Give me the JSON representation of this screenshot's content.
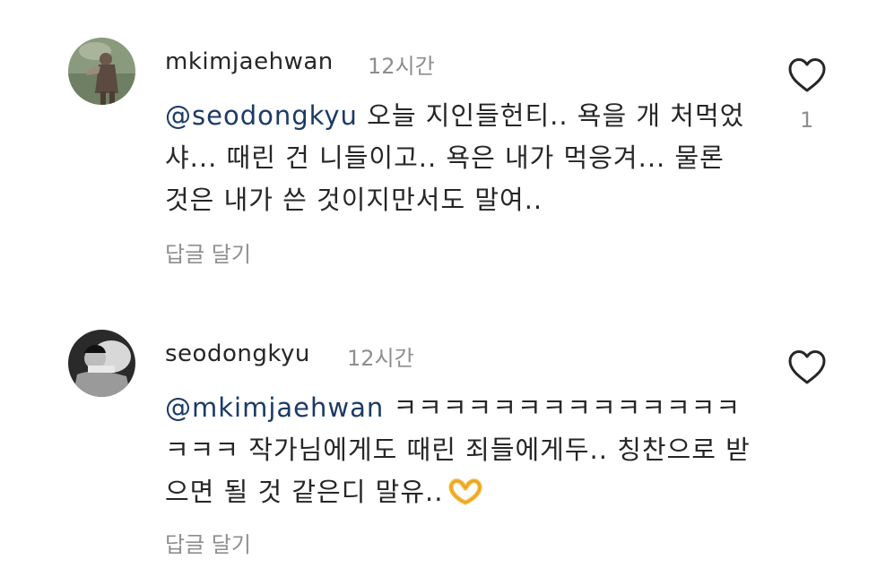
{
  "comments": [
    {
      "username": "mkimjaehwan",
      "time": "12시간",
      "mention": "@seodongkyu",
      "text": " 오늘 지인들헌티.. 욕을 개 처먹었샤... 때린 건 니들이고.. 욕은 내가 먹응겨... 물론 것은 내가 쓴 것이지만서도 말여..",
      "reply_label": "답글 달기",
      "like_count": "1",
      "avatar": "profile-photo"
    },
    {
      "username": "seodongkyu",
      "time": "12시간",
      "mention": "@mkimjaehwan",
      "text": " ㅋㅋㅋㅋㅋㅋㅋㅋㅋㅋㅋㅋㅋㅋㅋㅋㅋ 작가님에게도 때린 죄들에게두.. 칭찬으로 받으면 될 것 같은디 말유..",
      "emoji": "heart-hands-icon",
      "reply_label": "답글 달기",
      "avatar": "profile-photo"
    }
  ],
  "colors": {
    "text": "#262626",
    "muted": "#8e8e8e",
    "mention": "#1b3a66",
    "emoji": "#f5b93a"
  }
}
